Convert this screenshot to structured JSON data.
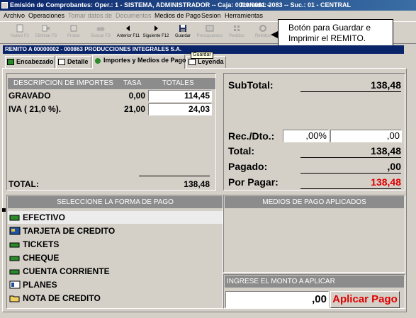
{
  "window": {
    "title": "Emisión de Comprobantes:  Oper.: 1 - SISTEMA, ADMINISTRADOR  -- Caja: 0010/0001  --",
    "title_right": "Jornada: 2083  -- Suc.: 01 - CENTRAL"
  },
  "menu": [
    "Archivo",
    "Operaciones",
    "Tomar datos de",
    "Documentos",
    "Medios de Pago",
    "Sesion",
    "Herramientas"
  ],
  "toolbar": {
    "nuevo": "Nuevo F2",
    "eliminar": "Eliminar F6",
    "probar": "Probar",
    "buscar": "Buscar F3",
    "anterior": "Anterior F11",
    "siguiente": "Siguiente F12",
    "guardar": "Guardar",
    "presupuestos": "Presupuestos",
    "pedidos": "Pedidos",
    "remitos": "Remitos"
  },
  "callout": "Botón para Guardar e Imprimir el REMITO.",
  "tooltip": "Guardar",
  "record_header": "REMITO A  00000002 - 000863  PRODUCCIONES INTEGRALES S.A.",
  "tabs": [
    "Encabezado",
    "Detalle",
    "Importes y Medios de Pago",
    "Leyenda"
  ],
  "importes": {
    "col_desc": "DESCRIPCION DE IMPORTES",
    "col_tasa": "TASA",
    "col_totales": "TOTALES",
    "rows": [
      {
        "desc": "GRAVADO",
        "tasa": "0,00",
        "total": "114,45"
      },
      {
        "desc": "IVA  ( 21,0 %).",
        "tasa": "21,00",
        "total": "24,03"
      }
    ],
    "total_label": "TOTAL:",
    "total_value": "138,48"
  },
  "summary": {
    "subtotal_label": "SubTotal:",
    "subtotal_value": "138,48",
    "recdto_label": "Rec./Dto.:",
    "recdto_pct": ",00%",
    "recdto_value": ",00",
    "total_label": "Total:",
    "total_value": "138,48",
    "pagado_label": "Pagado:",
    "pagado_value": ",00",
    "porpagar_label": "Por Pagar:",
    "porpagar_value": "138,48"
  },
  "forma_pago": {
    "header": "SELECCIONE LA FORMA DE PAGO",
    "items": [
      "EFECTIVO",
      "TARJETA DE CREDITO",
      "TICKETS",
      "CHEQUE",
      "CUENTA CORRIENTE",
      "PLANES",
      "NOTA DE CREDITO"
    ]
  },
  "medios_aplicados": {
    "header": "MEDIOS DE PAGO APLICADOS"
  },
  "monto": {
    "header": "INGRESE EL MONTO A APLICAR",
    "value": ",00",
    "button": "Aplicar Pago"
  },
  "colors": {
    "title_bar": "#0a246a",
    "porpagar": "#e00000",
    "apply_button_text": "#e00000"
  }
}
